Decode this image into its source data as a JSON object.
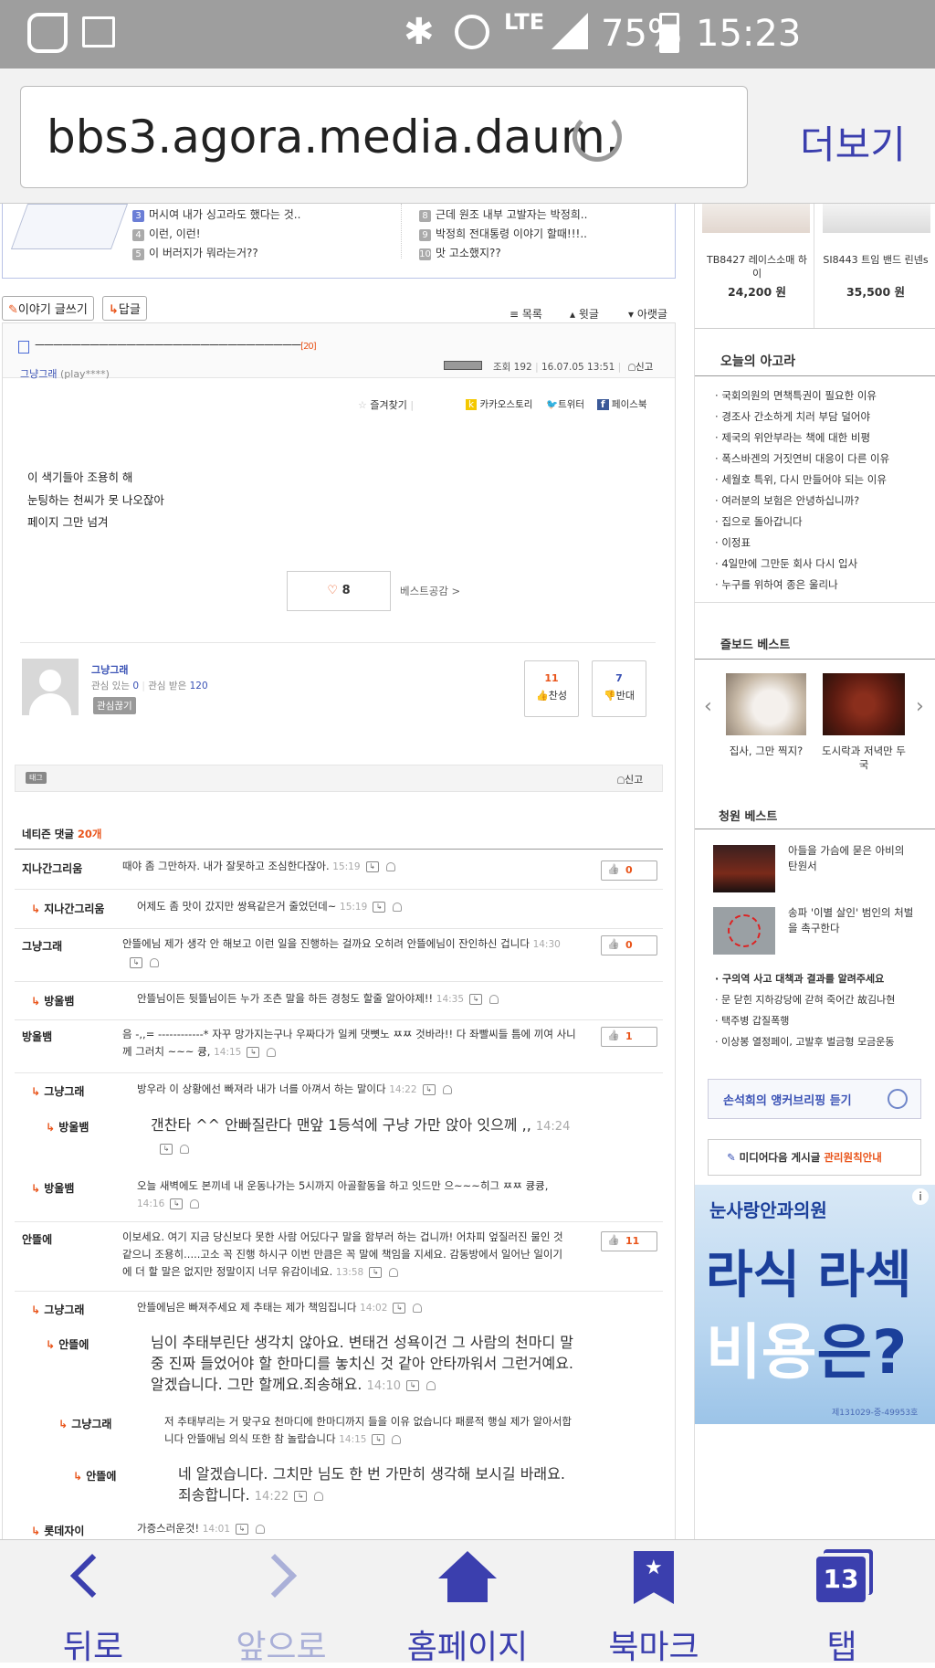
{
  "status_bar": {
    "battery": "75%",
    "time": "15:23",
    "network": "LTE"
  },
  "browser": {
    "url": "bbs3.agora.media.daum.ne",
    "more_label": "더보기"
  },
  "top_list": {
    "left": [
      {
        "num": "3",
        "text": "머시여 내가 싱고라도 했다는 것.."
      },
      {
        "num": "4",
        "text": "이런, 이런!"
      },
      {
        "num": "5",
        "text": "이 버러지가 뭐라는거??"
      }
    ],
    "right": [
      {
        "num": "8",
        "text": "근데 원조 내부 고발자는 박정희.."
      },
      {
        "num": "9",
        "text": "박정희 전대통령 이야기 할때!!!.."
      },
      {
        "num": "10",
        "text": "맛 고소했지??"
      }
    ]
  },
  "toolbar": {
    "write_label": "이야기 글쓰기",
    "reply_label": "답글",
    "list_label": "목록",
    "prev_label": "윗글",
    "next_label": "아랫글"
  },
  "post": {
    "title": "ㅡㅡㅡㅡㅡㅡㅡㅡㅡㅡㅡㅡㅡㅡㅡㅡㅡㅡㅡㅡㅡㅡㅡㅡㅡㅡㅡㅡㅡ",
    "title_count": "[20]",
    "author": "그냥그래",
    "author_id": "(play****)",
    "views_label": "조회",
    "views": "192",
    "date": "16.07.05 13:51",
    "report": "신고",
    "favorite": "즐겨찾기",
    "share": [
      "카카오스토리",
      "트위터",
      "페이스북"
    ],
    "body": [
      "이 색기들아 조용히 해",
      "눈팅하는 천씨가 못 나오잖아",
      "페이지 그만 넘겨"
    ],
    "likes": "8",
    "best_label": "베스트공감 >"
  },
  "profile": {
    "name": "그냥그래",
    "interest_label": "관심 있는",
    "interest": "0",
    "interested_label": "관심 받은",
    "interested": "120",
    "follow_btn": "관심끊기",
    "agree_count": "11",
    "agree_label": "찬성",
    "disagree_count": "7",
    "disagree_label": "반대"
  },
  "tag_bar": {
    "tag": "태그",
    "report": "신고"
  },
  "comments_header": {
    "label": "네티즌 댓글",
    "count": "20개"
  },
  "comments": [
    {
      "name": "지나간그리움",
      "text": "때야 좀 그만하자. 내가 잘못하고 조심한다잖아.",
      "time": "15:19",
      "likes": "0"
    },
    {
      "name": "지나간그리움",
      "text": "어제도 좀 맛이 갔지만 쌍욕같은거 줄었던데~",
      "time": "15:19",
      "likes": ""
    },
    {
      "name": "그냥그래",
      "text": "안뜰에님 제가 생각 안 해보고 이런 일을 진행하는 걸까요 오히려 안뜰에님이 잔인하신 겁니다",
      "time": "14:30",
      "likes": "0"
    },
    {
      "name": "방울뱀",
      "text": "안뜰님이든 뒷뜰님이든 누가 조츤 말을 하든 경청도 할줄 알아야제!!",
      "time": "14:35",
      "likes": ""
    },
    {
      "name": "방울뱀",
      "text": "음 -,,= ------------* 자꾸 망가지는구나 우짜다가 일케 댓뼛노 ㅉㅉ 것바라!! 다 좌빨씨들 틈에 끼여 사니께 그러치 ~~~ 큥,",
      "time": "14:15",
      "likes": "1"
    },
    {
      "name": "그냥그래",
      "text": "방우라 이 상황에선 빠져라 내가 너를 아껴서 하는 말이다",
      "time": "14:22",
      "likes": ""
    },
    {
      "name": "방울뱀",
      "text": "갠찬타 ^^ 안빠질란다 맨앞 1등석에 구냥 가만 앉아 잇으께 ,,",
      "time": "14:24",
      "likes": ""
    },
    {
      "name": "방울뱀",
      "text": "오늘 새벽에도 본끼네 내 운동나가는 5시까지 아골활동을 하고 잇드만 으~~~히그 ㅉㅉ 큥큥,",
      "time": "14:16",
      "likes": ""
    },
    {
      "name": "안뜰에",
      "text": "이보세요. 여기 지금 당신보다 못한 사람 어딨다구 말을 함부러 하는 겁니까! 어차피 엎질러진 물인 것 같으니 조용히.....고소 꼭 진행 하시구 이번 만큼은 꼭 말에 책임을 지세요. 감동방에서 일어난 일이기에 더 할 말은 없지만 정말이지 너무 유감이네요.",
      "time": "13:58",
      "likes": "11"
    },
    {
      "name": "그냥그래",
      "text": "안뜰에님은 빠져주세요 제 추태는 제가 책임집니다",
      "time": "14:02",
      "likes": ""
    },
    {
      "name": "안뜰에",
      "text": "님이 추태부린단 생각치 않아요. 변태건 성욕이건 그 사람의 천마디 말중 진짜 들었어야 할 한마디를 놓치신 것 같아 안타까워서 그런거예요. 알겠습니다. 그만 할께요.죄송해요.",
      "time": "14:10",
      "likes": ""
    },
    {
      "name": "그냥그래",
      "text": "저 추태부리는 거 맞구요 천마디에 한마디까지 들을 이유 없습니다 패륜적 행실 제가 알아서합니다 안뜰애님 의식 또한 참 놀랍습니다",
      "time": "14:15",
      "likes": ""
    },
    {
      "name": "안뜰에",
      "text": "네 알겠습니다. 그치만 님도 한 번 가만히 생각해 보시길 바래요. 죄송합니다.",
      "time": "14:22",
      "likes": ""
    },
    {
      "name": "롯데자이",
      "text": "가증스러운것!",
      "time": "14:01",
      "likes": ""
    }
  ],
  "sidebar": {
    "products": [
      {
        "name": "TB8427 레이스소매 하이",
        "price": "24,200 원"
      },
      {
        "name": "SI8443 트임 밴드 린넨s",
        "price": "35,500 원"
      }
    ],
    "today_title": "오늘의 아고라",
    "today_items": [
      "국회의원의 면책특권이 필요한 이유",
      "경조사 간소하게 치러 부담 덜어야",
      "제국의 위안부라는 책에 대한 비평",
      "폭스바겐의 거짓연비 대응이 다른 이유",
      "세월호 특위, 다시 만들어야 되는 이유",
      "여러분의 보험은 안녕하십니까?",
      "집으로 돌아갑니다",
      "이정표",
      "4일만에 그만둔 회사 다시 입사",
      "누구를 위하여 종은 울리나"
    ],
    "board_title": "즐보드 베스트",
    "board_items": [
      {
        "title": "집사, 그만 찍지?"
      },
      {
        "title": "도시락과 저녁만 두국"
      }
    ],
    "petition_title": "청원 베스트",
    "petition_items": [
      {
        "title": "아들을 가슴에 묻은 아비의 탄원서"
      },
      {
        "title": "송파 '이별 살인' 범인의 처벌을 촉구한다"
      }
    ],
    "petition_list": [
      "구의역 사고 대책과 결과를 알려주세요",
      "문 닫힌 지하강당에 갇혀 죽어간 故김나현",
      "택주병 갑질폭행",
      "이상봉 열정페이, 고발후 벌금형 모금운동"
    ],
    "briefing": "손석희의 앵커브리핑 듣기",
    "notice": "미디어다음 게시글",
    "notice_link": "관리원칙안내",
    "ad": {
      "brand": "눈사랑안과의원",
      "line1": "라식 라섹",
      "line2a": "비용",
      "line2b": "은?",
      "code": "제131029-중-49953호",
      "info": "i"
    }
  },
  "tabbar": {
    "back": "뒤로",
    "forward": "앞으로",
    "home": "홈페이지",
    "bookmark": "북마크",
    "tabs": "탭",
    "tab_count": "13"
  }
}
